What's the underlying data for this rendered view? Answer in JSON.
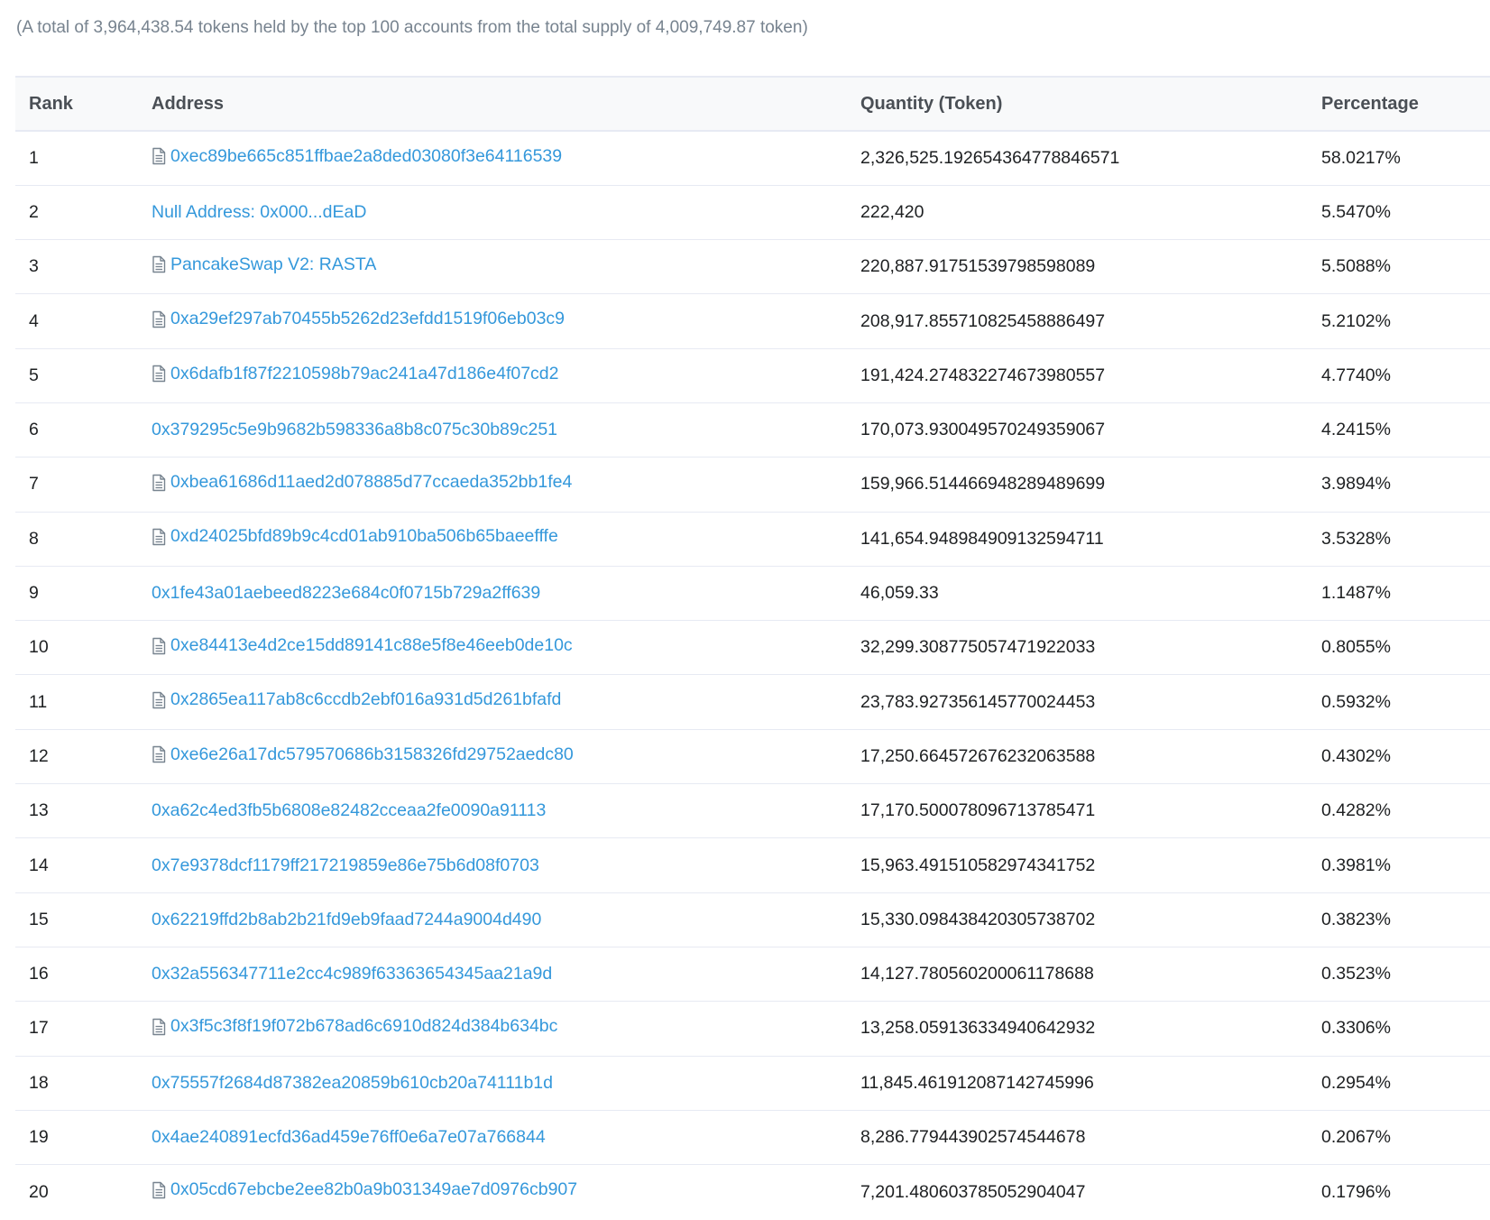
{
  "summary": "(A total of 3,964,438.54 tokens held by the top 100 accounts from the total supply of 4,009,749.87 token)",
  "table": {
    "headers": {
      "rank": "Rank",
      "address": "Address",
      "quantity": "Quantity (Token)",
      "percentage": "Percentage"
    },
    "rows": [
      {
        "rank": "1",
        "address": "0xec89be665c851ffbae2a8ded03080f3e64116539",
        "is_contract": true,
        "quantity": "2,326,525.19265436477884657​1",
        "percentage": "58.0217%"
      },
      {
        "rank": "2",
        "address": "Null Address: 0x000...dEaD",
        "is_contract": false,
        "quantity": "222,420",
        "percentage": "5.5470%"
      },
      {
        "rank": "3",
        "address": "PancakeSwap V2: RASTA",
        "is_contract": true,
        "quantity": "220,887.91751539798598089",
        "percentage": "5.5088%"
      },
      {
        "rank": "4",
        "address": "0xa29ef297ab70455b5262d23efdd1519f06eb03c9",
        "is_contract": true,
        "quantity": "208,917.855710825458886497",
        "percentage": "5.2102%"
      },
      {
        "rank": "5",
        "address": "0x6dafb1f87f2210598b79ac241a47d186e4f07cd2",
        "is_contract": true,
        "quantity": "191,424.274832274673980557",
        "percentage": "4.7740%"
      },
      {
        "rank": "6",
        "address": "0x379295c5e9b9682b598336a8b8c075c30b89c251",
        "is_contract": false,
        "quantity": "170,073.930049570249359067",
        "percentage": "4.2415%"
      },
      {
        "rank": "7",
        "address": "0xbea61686d11aed2d078885d77ccaeda352bb1fe4",
        "is_contract": true,
        "quantity": "159,966.514466948289489699",
        "percentage": "3.9894%"
      },
      {
        "rank": "8",
        "address": "0xd24025bfd89b9c4cd01ab910ba506b65baeefffe",
        "is_contract": true,
        "quantity": "141,654.948984909132594711",
        "percentage": "3.5328%"
      },
      {
        "rank": "9",
        "address": "0x1fe43a01aebeed8223e684c0f0715b729a2ff639",
        "is_contract": false,
        "quantity": "46,059.33",
        "percentage": "1.1487%"
      },
      {
        "rank": "10",
        "address": "0xe84413e4d2ce15dd89141c88e5f8e46eeb0de10c",
        "is_contract": true,
        "quantity": "32,299.308775057471922033",
        "percentage": "0.8055%"
      },
      {
        "rank": "11",
        "address": "0x2865ea117ab8c6ccdb2ebf016a931d5d261bfafd",
        "is_contract": true,
        "quantity": "23,783.927356145770024453",
        "percentage": "0.5932%"
      },
      {
        "rank": "12",
        "address": "0xe6e26a17dc579570686b3158326fd29752aedc80",
        "is_contract": true,
        "quantity": "17,250.664572676232063588",
        "percentage": "0.4302%"
      },
      {
        "rank": "13",
        "address": "0xa62c4ed3fb5b6808e82482cceaa2fe0090a91113",
        "is_contract": false,
        "quantity": "17,170.500078096713785471",
        "percentage": "0.4282%"
      },
      {
        "rank": "14",
        "address": "0x7e9378dcf1179ff217219859e86e75b6d08f0703",
        "is_contract": false,
        "quantity": "15,963.491510582974341752",
        "percentage": "0.3981%"
      },
      {
        "rank": "15",
        "address": "0x62219ffd2b8ab2b21fd9eb9faad7244a9004d490",
        "is_contract": false,
        "quantity": "15,330.098438420305738702",
        "percentage": "0.3823%"
      },
      {
        "rank": "16",
        "address": "0x32a556347711e2cc4c989f63363654345aa21a9d",
        "is_contract": false,
        "quantity": "14,127.780560200061178688",
        "percentage": "0.3523%"
      },
      {
        "rank": "17",
        "address": "0x3f5c3f8f19f072b678ad6c6910d824d384b634bc",
        "is_contract": true,
        "quantity": "13,258.059136334940642932",
        "percentage": "0.3306%"
      },
      {
        "rank": "18",
        "address": "0x75557f2684d87382ea20859b610cb20a74111b1d",
        "is_contract": false,
        "quantity": "11,845.461912087142745996",
        "percentage": "0.2954%"
      },
      {
        "rank": "19",
        "address": "0x4ae240891ecfd36ad459e76ff0e6a7e07a766844",
        "is_contract": false,
        "quantity": "8,286.779443902574544678",
        "percentage": "0.2067%"
      },
      {
        "rank": "20",
        "address": "0x05cd67ebcbe2ee82b0a9b031349ae7d0976cb907",
        "is_contract": true,
        "quantity": "7,201.480603785052904047",
        "percentage": "0.1796%"
      }
    ]
  },
  "icons": {
    "contract": "file-document-icon"
  },
  "colors": {
    "link": "#3498db",
    "muted_text": "#77838f",
    "border": "#e7eaf3",
    "header_bg": "#f8f9fa"
  }
}
